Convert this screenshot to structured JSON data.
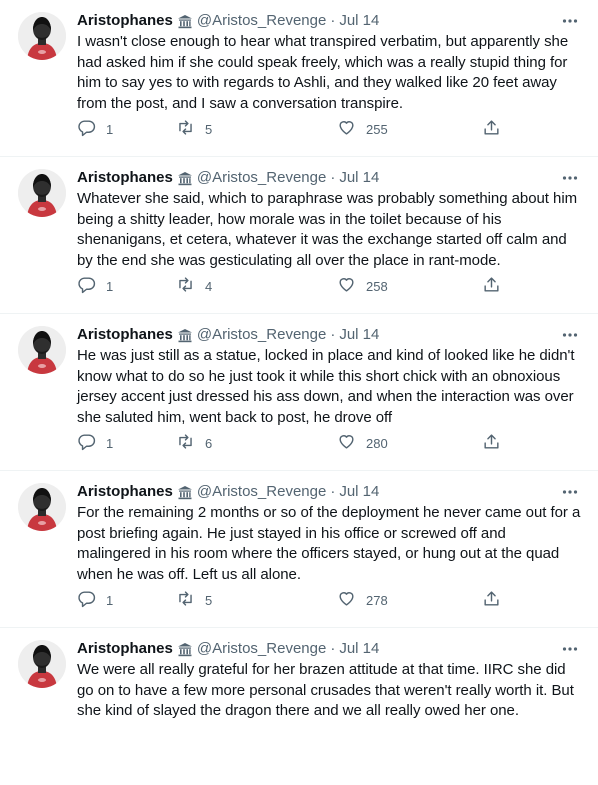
{
  "colors": {
    "text": "#0f1419",
    "secondary": "#536471",
    "border": "#eff3f4"
  },
  "icons": [
    "reply-icon",
    "retweet-icon",
    "like-icon",
    "share-icon",
    "more-icon",
    "government-badge-icon"
  ],
  "tweets": [
    {
      "name": "Aristophanes",
      "handle": "@Aristos_Revenge",
      "separator": "·",
      "date": "Jul 14",
      "text": "I wasn't close enough to hear what transpired verbatim, but apparently she had asked him if she could speak freely, which was a really stupid thing for him to say yes to with regards to Ashli, and they walked like 20 feet away from the post, and I saw a conversation transpire.",
      "replies": "1",
      "retweets": "5",
      "likes": "255"
    },
    {
      "name": "Aristophanes",
      "handle": "@Aristos_Revenge",
      "separator": "·",
      "date": "Jul 14",
      "text": "Whatever she said, which to paraphrase was probably something about him being a shitty leader, how morale was in the toilet because of his shenanigans, et cetera, whatever it was the exchange started off calm and by the end she was gesticulating all over the place in rant-mode.",
      "replies": "1",
      "retweets": "4",
      "likes": "258"
    },
    {
      "name": "Aristophanes",
      "handle": "@Aristos_Revenge",
      "separator": "·",
      "date": "Jul 14",
      "text": "He was just still as a statue, locked in place and kind of looked like he didn't know what to do so he just took it while this short chick with an obnoxious jersey accent just dressed his ass down, and when the interaction was over she saluted him, went back to post, he drove off",
      "replies": "1",
      "retweets": "6",
      "likes": "280"
    },
    {
      "name": "Aristophanes",
      "handle": "@Aristos_Revenge",
      "separator": "·",
      "date": "Jul 14",
      "text": "For the remaining 2 months or so of the deployment he never came out for a post briefing again. He just stayed in his office or screwed off and malingered in his room where the officers stayed, or hung out at the quad when he was off. Left us all alone.",
      "replies": "1",
      "retweets": "5",
      "likes": "278"
    },
    {
      "name": "Aristophanes",
      "handle": "@Aristos_Revenge",
      "separator": "·",
      "date": "Jul 14",
      "text": "We were all really grateful for her brazen attitude at that time. IIRC she did go on to have a few more personal crusades that weren't really worth it. But she kind of slayed the dragon there and we all really owed her one.",
      "replies": "",
      "retweets": "",
      "likes": ""
    }
  ]
}
